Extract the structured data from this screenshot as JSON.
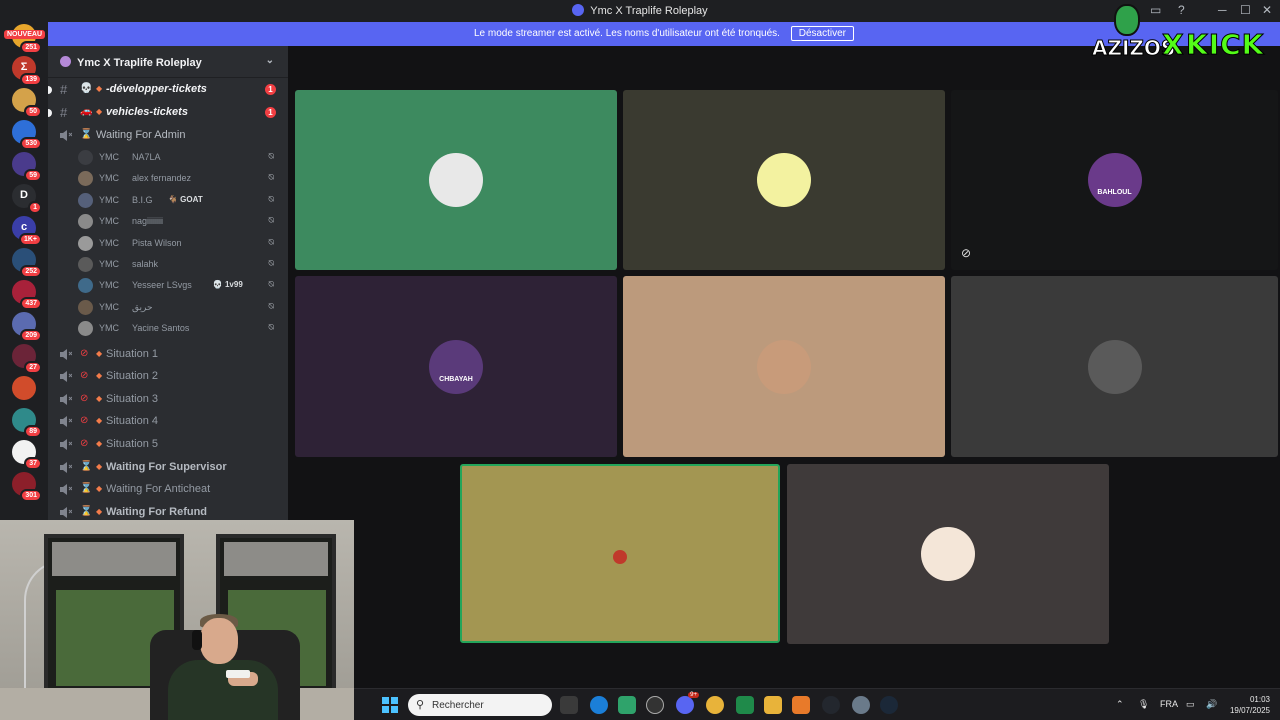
{
  "window": {
    "title": "Ymc X Traplife Roleplay"
  },
  "banner": {
    "text": "Le mode streamer est activé. Les noms d'utilisateur ont été tronqués.",
    "button": "Désactiver"
  },
  "overlay": {
    "brand_left": "AZIZOS",
    "brand_x": "X",
    "brand_right": "KICK"
  },
  "servers": {
    "nouveau": "NOUVEAU",
    "items": [
      {
        "badge": "251",
        "color": "#e8a62c",
        "text": ""
      },
      {
        "badge": "139",
        "color": "#c0392b",
        "text": "Σ"
      },
      {
        "badge": "50",
        "color": "#d4a24a",
        "text": ""
      },
      {
        "badge": "530",
        "color": "#2e6fd8",
        "text": ""
      },
      {
        "badge": "59",
        "color": "#4a3b8c",
        "text": ""
      },
      {
        "badge": "1",
        "color": "#2b2d31",
        "text": "D"
      },
      {
        "badge": "1K+",
        "color": "#3a3ea8",
        "text": "c"
      },
      {
        "badge": "252",
        "color": "#2a4f78",
        "text": ""
      },
      {
        "badge": "437",
        "color": "#a8213a",
        "text": ""
      },
      {
        "badge": "209",
        "color": "#5b6bb0",
        "text": ""
      },
      {
        "badge": "27",
        "color": "#6b2438",
        "text": ""
      },
      {
        "badge": "",
        "color": "#d14c2b",
        "text": ""
      },
      {
        "badge": "89",
        "color": "#2f8a8a",
        "text": ""
      },
      {
        "badge": "37",
        "color": "#f2f2f2",
        "text": ""
      },
      {
        "badge": "301",
        "color": "#8c1f2a",
        "text": ""
      }
    ]
  },
  "guild": {
    "name": "Ymc X Traplife Roleplay"
  },
  "channels": {
    "text": [
      {
        "icon": "💀",
        "name": "-développer-tickets",
        "unread": "1"
      },
      {
        "icon": "🚗",
        "name": "vehicles-tickets",
        "unread": "1"
      }
    ],
    "waiting_admin": "Waiting For Admin",
    "users": [
      {
        "tag": "YMC",
        "name": "NA7LA",
        "extra": "",
        "color": "#3b3d42"
      },
      {
        "tag": "YMC",
        "name": "alex fernandez",
        "extra": "",
        "color": "#7a6a5a"
      },
      {
        "tag": "YMC",
        "name": "B.I.G",
        "extra": "🐐 GOAT",
        "color": "#55607a"
      },
      {
        "tag": "YMC",
        "name": "nagiiiiiiii",
        "extra": "",
        "color": "#8a8a8a"
      },
      {
        "tag": "YMC",
        "name": "Pista Wilson",
        "extra": "",
        "color": "#9a9a9a"
      },
      {
        "tag": "YMC",
        "name": "salahk",
        "extra": "",
        "color": "#5a5a5a"
      },
      {
        "tag": "YMC",
        "name": "Yesseer LSvgs",
        "extra": "💀 1v99",
        "color": "#3f6a8a"
      },
      {
        "tag": "YMC",
        "name": "حريق",
        "extra": "",
        "color": "#6a5a4a"
      },
      {
        "tag": "YMC",
        "name": "Yacine Santos",
        "extra": "",
        "color": "#8a8a8a"
      }
    ],
    "situations": [
      "Situation 1",
      "Situation 2",
      "Situation 3",
      "Situation 4",
      "Situation 5"
    ],
    "waiting": [
      {
        "name": "Waiting For Supervisor",
        "bold": true
      },
      {
        "name": "Waiting For Anticheat",
        "bold": false
      },
      {
        "name": "Waiting For Refund",
        "bold": true
      }
    ]
  },
  "tiles": [
    {
      "bg": "#3d8a5f",
      "avatar": "#e8e8e8",
      "label": ""
    },
    {
      "bg": "#3a3a30",
      "avatar": "#f3f2a0",
      "label": ""
    },
    {
      "bg": "#151617",
      "avatar": "#6a3a8a",
      "label": "BAHLOUL"
    },
    {
      "bg": "#2e2236",
      "avatar": "#5a3a7a",
      "label": "CHBAYAH"
    },
    {
      "bg": "#bc9a7c",
      "avatar": "#c89b7a",
      "label": ""
    },
    {
      "bg": "#3a3a3a",
      "avatar": "#5a5a5a",
      "label": ""
    },
    {
      "bg": "#a39652",
      "avatar": "#a39652",
      "label": ""
    },
    {
      "bg": "#3f3a3a",
      "avatar": "#f4e6d8",
      "label": ""
    }
  ],
  "taskbar": {
    "search_placeholder": "Rechercher",
    "lang": "FRA",
    "time": "01:03",
    "date": "19/07/2025",
    "discord_badge": "9+"
  }
}
